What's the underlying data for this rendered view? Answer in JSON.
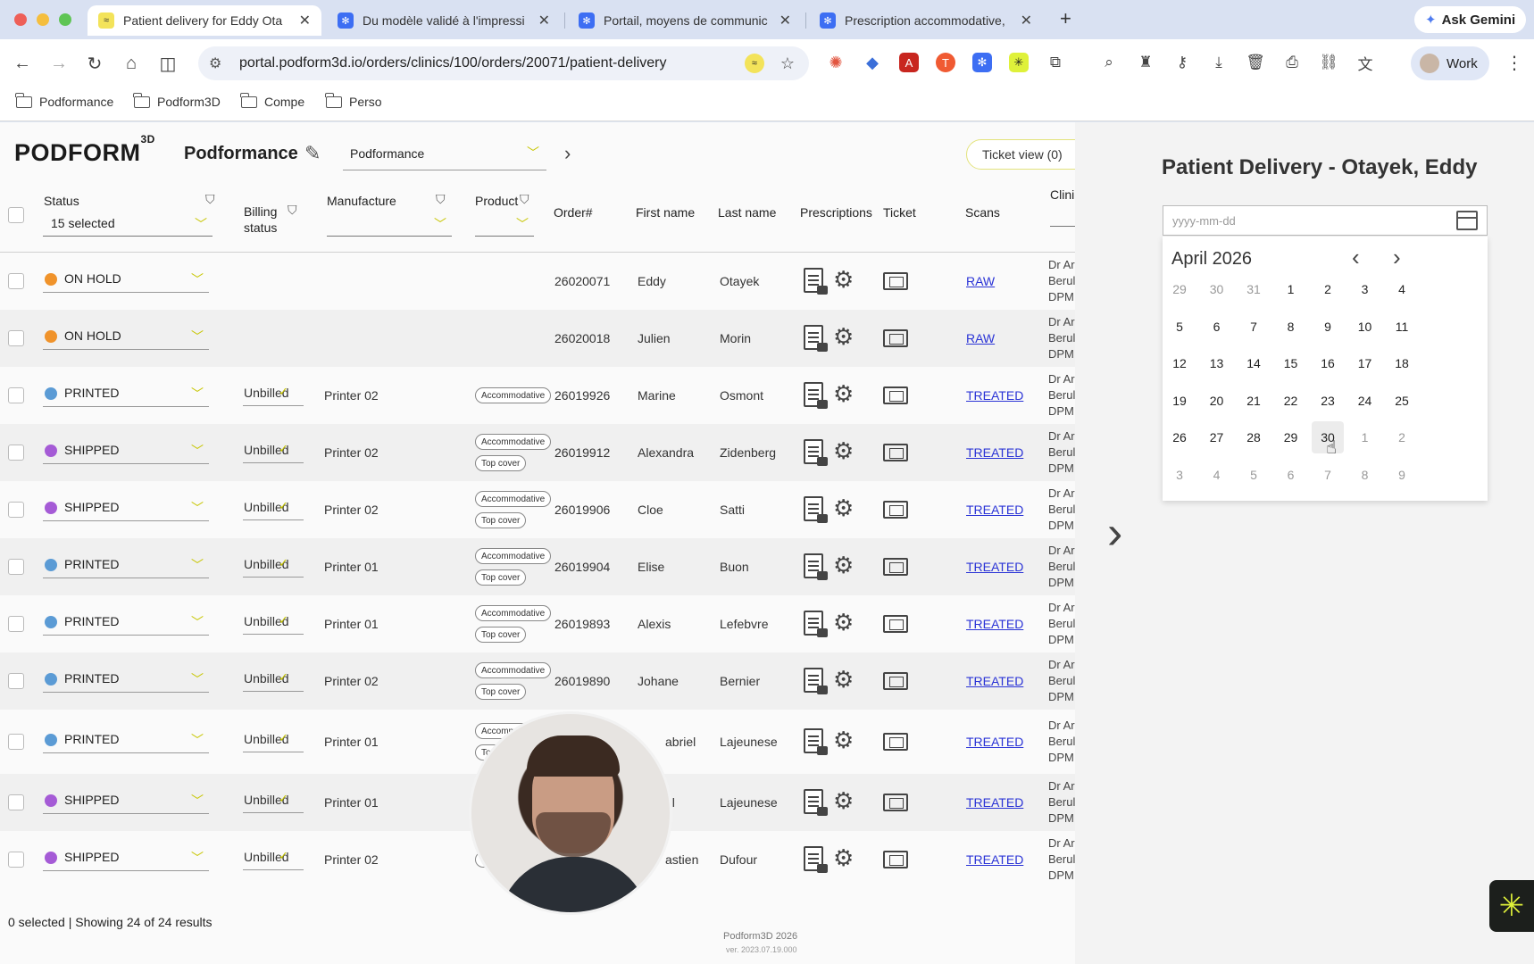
{
  "browser": {
    "tabs": [
      {
        "title": "Patient delivery for Eddy Ota",
        "favicon": "podform-icon",
        "active": true
      },
      {
        "title": "Du modèle validé à l'impressi",
        "favicon": "jira-icon",
        "active": false
      },
      {
        "title": "Portail, moyens de communic",
        "favicon": "jira-icon",
        "active": false
      },
      {
        "title": "Prescription accommodative,",
        "favicon": "jira-icon",
        "active": false
      }
    ],
    "ask_gemini": "Ask Gemini",
    "url": "portal.podform3d.io/orders/clinics/100/orders/20071/patient-delivery",
    "profile": "Work",
    "bookmarks": [
      "Podformance",
      "Podform3D",
      "Compe",
      "Perso"
    ]
  },
  "app": {
    "logo_text": "PODFORM",
    "logo_sup": "3D",
    "clinic_name": "Podformance",
    "clinic_select": "Podformance",
    "ticket_view": "Ticket view (0)",
    "columns": {
      "status": "Status",
      "status_filter": "15 selected",
      "billing": "Billing",
      "billing2": "status",
      "manufacture": "Manufacture",
      "product": "Product",
      "order": "Order#",
      "first": "First name",
      "last": "Last name",
      "prescriptions": "Prescriptions",
      "ticket": "Ticket",
      "scans": "Scans",
      "clinic": "Clini"
    },
    "rows": [
      {
        "status": "ON HOLD",
        "color": "#f0932b",
        "billing": "",
        "manufacture": "",
        "chips": [],
        "order": "26020071",
        "first": "Eddy",
        "last": "Otayek",
        "scan": "RAW"
      },
      {
        "status": "ON HOLD",
        "color": "#f0932b",
        "billing": "",
        "manufacture": "",
        "chips": [],
        "order": "26020018",
        "first": "Julien",
        "last": "Morin",
        "scan": "RAW"
      },
      {
        "status": "PRINTED",
        "color": "#5b9bd5",
        "billing": "Unbilled",
        "manufacture": "Printer 02",
        "chips": [
          "Accommodative"
        ],
        "order": "26019926",
        "first": "Marine",
        "last": "Osmont",
        "scan": "TREATED"
      },
      {
        "status": "SHIPPED",
        "color": "#a55bd6",
        "billing": "Unbilled",
        "manufacture": "Printer 02",
        "chips": [
          "Accommodative",
          "Top cover"
        ],
        "order": "26019912",
        "first": "Alexandra",
        "last": "Zidenberg",
        "scan": "TREATED"
      },
      {
        "status": "SHIPPED",
        "color": "#a55bd6",
        "billing": "Unbilled",
        "manufacture": "Printer 02",
        "chips": [
          "Accommodative",
          "Top cover"
        ],
        "order": "26019906",
        "first": "Cloe",
        "last": "Satti",
        "scan": "TREATED"
      },
      {
        "status": "PRINTED",
        "color": "#5b9bd5",
        "billing": "Unbilled",
        "manufacture": "Printer 01",
        "chips": [
          "Accommodative",
          "Top cover"
        ],
        "order": "26019904",
        "first": "Elise",
        "last": "Buon",
        "scan": "TREATED"
      },
      {
        "status": "PRINTED",
        "color": "#5b9bd5",
        "billing": "Unbilled",
        "manufacture": "Printer 01",
        "chips": [
          "Accommodative",
          "Top cover"
        ],
        "order": "26019893",
        "first": "Alexis",
        "last": "Lefebvre",
        "scan": "TREATED"
      },
      {
        "status": "PRINTED",
        "color": "#5b9bd5",
        "billing": "Unbilled",
        "manufacture": "Printer 02",
        "chips": [
          "Accommodative",
          "Top cover"
        ],
        "order": "26019890",
        "first": "Johane",
        "last": "Bernier",
        "scan": "TREATED"
      },
      {
        "status": "PRINTED",
        "color": "#5b9bd5",
        "billing": "Unbilled",
        "manufacture": "Printer 01",
        "chips": [
          "Accommodative",
          "Top"
        ],
        "order": "",
        "first": "abriel",
        "last": "Lajeunese",
        "scan": "TREATED"
      },
      {
        "status": "SHIPPED",
        "color": "#a55bd6",
        "billing": "Unbilled",
        "manufacture": "Printer 01",
        "chips": [],
        "order": "",
        "first": "el",
        "last": "Lajeunese",
        "scan": "TREATED"
      },
      {
        "status": "SHIPPED",
        "color": "#a55bd6",
        "billing": "Unbilled",
        "manufacture": "Printer 02",
        "chips": [
          "To"
        ],
        "order": "",
        "first": "astien",
        "last": "Dufour",
        "scan": "TREATED"
      }
    ],
    "clinic_lines": [
      "Dr Ar",
      "Berul",
      "DPM"
    ],
    "footer_selection": "0 selected | Showing 24 of 24 results",
    "footer_brand": "Podform3D 2026",
    "footer_version": "ver. 2023.07.19.000"
  },
  "panel": {
    "title": "Patient Delivery - Otayek, Eddy",
    "date_placeholder": "yyyy-mm-dd",
    "month": "April 2026",
    "weeks": [
      [
        "29",
        "30",
        "31",
        "1",
        "2",
        "3",
        "4"
      ],
      [
        "5",
        "6",
        "7",
        "8",
        "9",
        "10",
        "11"
      ],
      [
        "12",
        "13",
        "14",
        "15",
        "16",
        "17",
        "18"
      ],
      [
        "19",
        "20",
        "21",
        "22",
        "23",
        "24",
        "25"
      ],
      [
        "26",
        "27",
        "28",
        "29",
        "30",
        "1",
        "2"
      ],
      [
        "3",
        "4",
        "5",
        "6",
        "7",
        "8",
        "9"
      ]
    ]
  }
}
